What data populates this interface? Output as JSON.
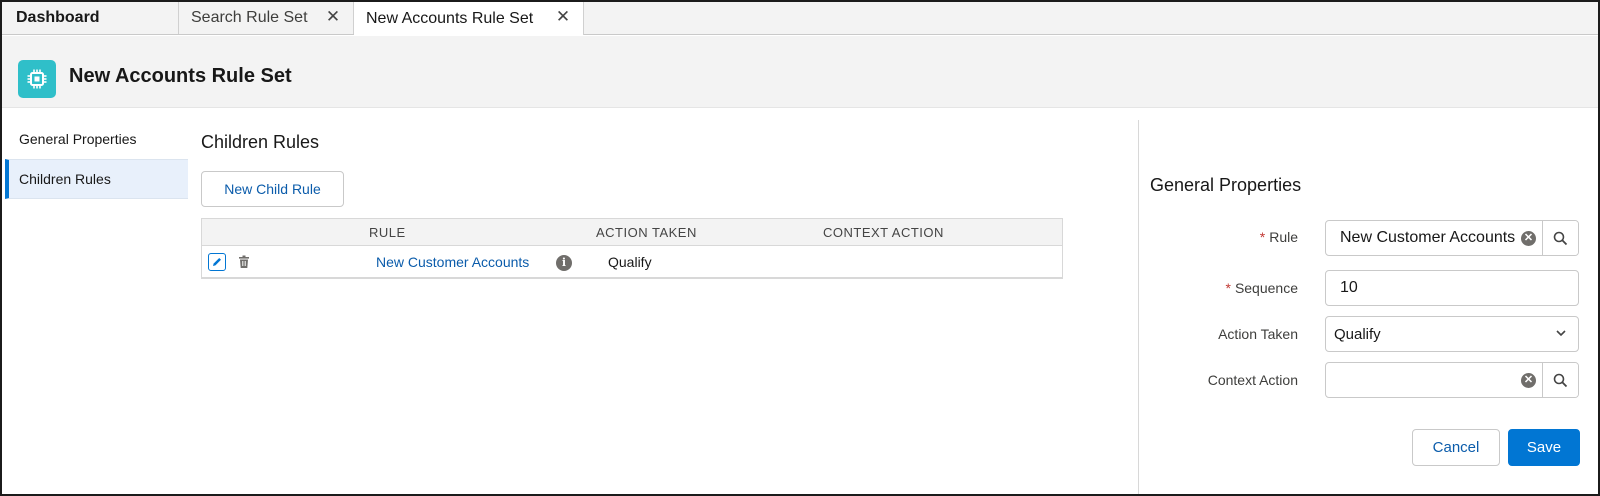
{
  "tabs": {
    "home": "Dashboard",
    "items": [
      {
        "label": "Search Rule Set"
      },
      {
        "label": "New Accounts Rule Set"
      }
    ]
  },
  "header": {
    "title": "New Accounts Rule Set",
    "icon": "rule-chip-icon",
    "icon_color": "#2fbfc9"
  },
  "nav": {
    "items": [
      {
        "label": "General Properties",
        "active": false
      },
      {
        "label": "Children Rules",
        "active": true
      }
    ]
  },
  "main": {
    "title": "Children Rules",
    "new_button": "New Child Rule",
    "table": {
      "columns": [
        "RULE",
        "ACTION TAKEN",
        "CONTEXT ACTION"
      ],
      "rows": [
        {
          "rule": "New Customer Accounts",
          "action_taken": "Qualify",
          "context_action": ""
        }
      ]
    }
  },
  "panel": {
    "title": "General Properties",
    "fields": {
      "rule": {
        "label": "Rule",
        "required": true,
        "value": "New Customer Accounts"
      },
      "sequence": {
        "label": "Sequence",
        "required": true,
        "value": "10"
      },
      "action_taken": {
        "label": "Action Taken",
        "value": "Qualify"
      },
      "context_action": {
        "label": "Context Action",
        "value": ""
      }
    },
    "cancel_label": "Cancel",
    "save_label": "Save"
  },
  "colors": {
    "brand_blue": "#0176d3",
    "link_blue": "#0b5cab",
    "required_red": "#c23934"
  }
}
